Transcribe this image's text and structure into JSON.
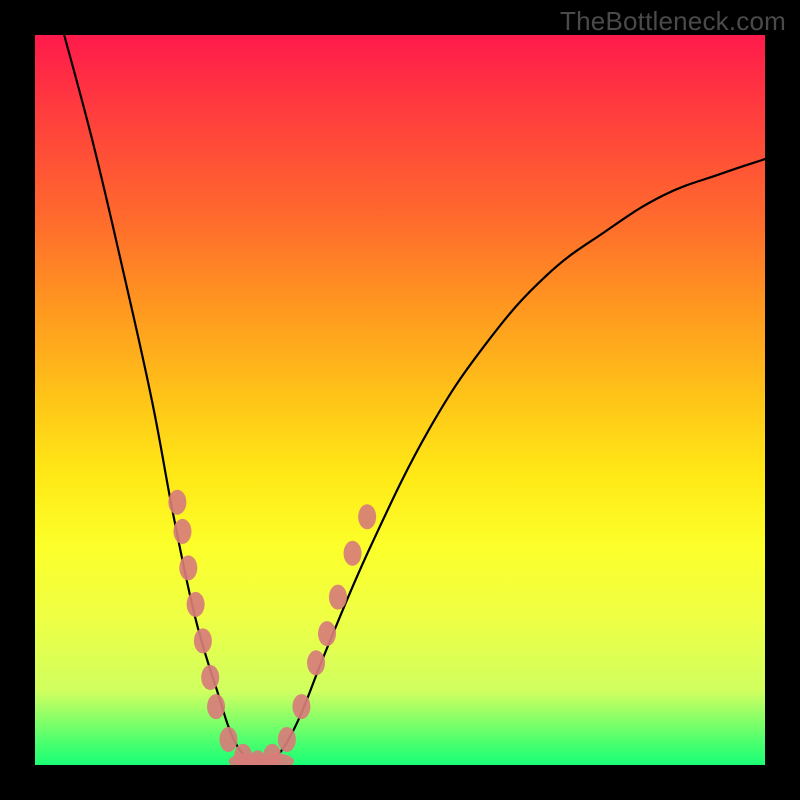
{
  "watermark": "TheBottleneck.com",
  "chart_data": {
    "type": "line",
    "title": "",
    "xlabel": "",
    "ylabel": "",
    "xlim": [
      0,
      100
    ],
    "ylim": [
      0,
      100
    ],
    "background_gradient_stops": [
      {
        "pct": 0,
        "color": "#ff1a4b"
      },
      {
        "pct": 50,
        "color": "#ffc518"
      },
      {
        "pct": 80,
        "color": "#eeff45"
      },
      {
        "pct": 100,
        "color": "#1aff77"
      }
    ],
    "curve_points_xy_pct": [
      [
        4,
        100
      ],
      [
        8,
        85
      ],
      [
        12,
        68
      ],
      [
        16,
        50
      ],
      [
        19,
        34
      ],
      [
        22,
        20
      ],
      [
        25,
        10
      ],
      [
        27,
        4
      ],
      [
        29,
        1
      ],
      [
        31,
        0
      ],
      [
        33,
        1
      ],
      [
        36,
        6
      ],
      [
        40,
        16
      ],
      [
        46,
        30
      ],
      [
        54,
        46
      ],
      [
        62,
        58
      ],
      [
        70,
        67
      ],
      [
        78,
        73
      ],
      [
        86,
        78
      ],
      [
        94,
        81
      ],
      [
        100,
        83
      ]
    ],
    "markers_xy_pct": [
      [
        19.5,
        36
      ],
      [
        20.2,
        32
      ],
      [
        21.0,
        27
      ],
      [
        22.0,
        22
      ],
      [
        23.0,
        17
      ],
      [
        24.0,
        12
      ],
      [
        24.8,
        8
      ],
      [
        26.5,
        3.5
      ],
      [
        28.5,
        1.2
      ],
      [
        30.5,
        0.3
      ],
      [
        32.5,
        1.2
      ],
      [
        34.5,
        3.5
      ],
      [
        36.5,
        8
      ],
      [
        38.5,
        14
      ],
      [
        40.0,
        18
      ],
      [
        41.5,
        23
      ],
      [
        43.5,
        29
      ],
      [
        45.5,
        34
      ]
    ],
    "valley_blob_xy_pct": [
      [
        29,
        0.5
      ],
      [
        33,
        0.5
      ]
    ],
    "annotation_note": "V-shaped bottleneck curve; minimum roughly at x≈31% (y≈0). Left branch rises steeply toward x≈4% (y=100). Right branch rises and flattens toward y≈83 at x=100%. Pink markers cluster along both branches between y≈0 and y≈36."
  }
}
